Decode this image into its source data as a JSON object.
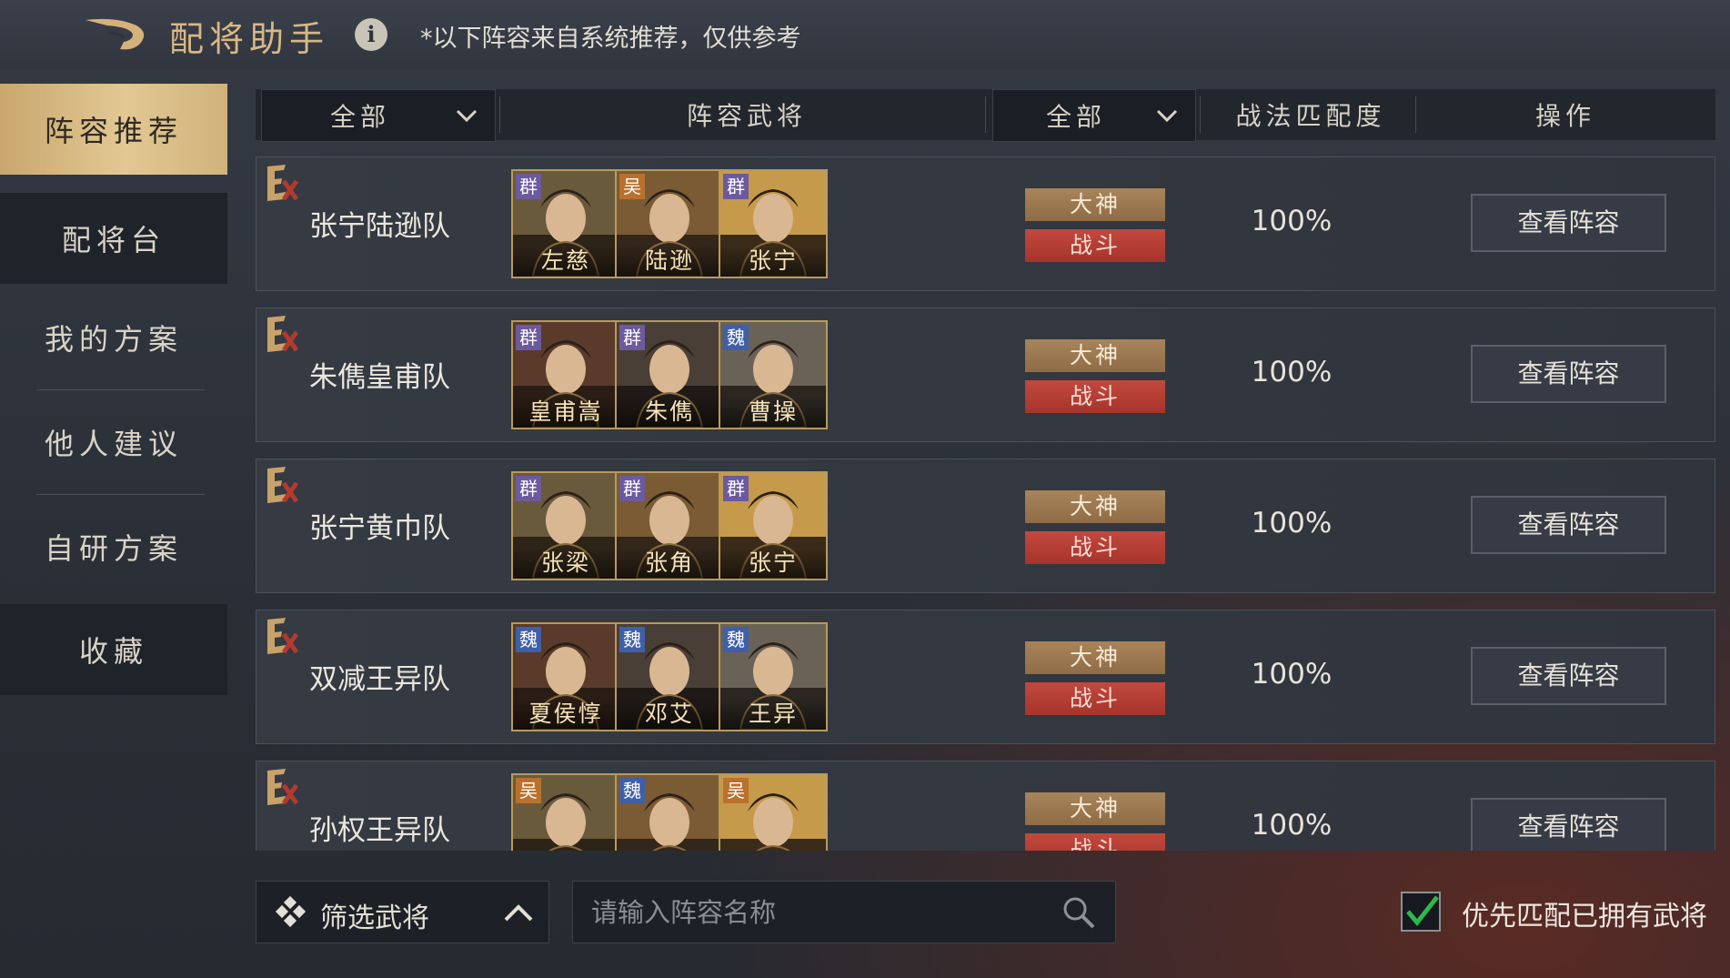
{
  "header": {
    "title": "配将助手",
    "info_icon": "info-icon",
    "info_glyph": "i",
    "notice": "*以下阵容来自系统推荐，仅供参考"
  },
  "sidebar": {
    "items": [
      {
        "label": "阵容推荐",
        "active": true
      },
      {
        "label": "配将台"
      },
      {
        "label": "我的方案"
      },
      {
        "label": "他人建议"
      },
      {
        "label": "自研方案"
      },
      {
        "label": "收藏"
      }
    ]
  },
  "table": {
    "headers": {
      "filter1": "全部",
      "lineup": "阵容武将",
      "filter2": "全部",
      "match": "战法匹配度",
      "action": "操作"
    },
    "rows": [
      {
        "name": "张宁陆逊队",
        "generals": [
          {
            "name": "左慈",
            "faction": "群"
          },
          {
            "name": "陆逊",
            "faction": "吴"
          },
          {
            "name": "张宁",
            "faction": "群"
          }
        ],
        "tags": [
          "大神",
          "战斗"
        ],
        "match": "100%",
        "button": "查看阵容"
      },
      {
        "name": "朱儁皇甫队",
        "generals": [
          {
            "name": "皇甫嵩",
            "faction": "群"
          },
          {
            "name": "朱儁",
            "faction": "群"
          },
          {
            "name": "曹操",
            "faction": "魏"
          }
        ],
        "tags": [
          "大神",
          "战斗"
        ],
        "match": "100%",
        "button": "查看阵容"
      },
      {
        "name": "张宁黄巾队",
        "generals": [
          {
            "name": "张梁",
            "faction": "群"
          },
          {
            "name": "张角",
            "faction": "群"
          },
          {
            "name": "张宁",
            "faction": "群"
          }
        ],
        "tags": [
          "大神",
          "战斗"
        ],
        "match": "100%",
        "button": "查看阵容"
      },
      {
        "name": "双减王异队",
        "generals": [
          {
            "name": "夏侯惇",
            "faction": "魏"
          },
          {
            "name": "邓艾",
            "faction": "魏"
          },
          {
            "name": "王异",
            "faction": "魏"
          }
        ],
        "tags": [
          "大神",
          "战斗"
        ],
        "match": "100%",
        "button": "查看阵容"
      },
      {
        "name": "孙权王异队",
        "generals": [
          {
            "name": "",
            "faction": "吴"
          },
          {
            "name": "",
            "faction": "魏"
          },
          {
            "name": "",
            "faction": "吴"
          }
        ],
        "tags": [
          "大神",
          "战斗"
        ],
        "match": "100%",
        "button": "查看阵容"
      }
    ]
  },
  "bottom": {
    "filter_label": "筛选武将",
    "search_placeholder": "请输入阵容名称",
    "checkbox_label": "优先匹配已拥有武将",
    "checkbox_checked": true
  },
  "colors": {
    "accent_gold": "#d8b786",
    "tag_gold": "#a8845a",
    "tag_red": "#c2493e",
    "check_green": "#2fb84a",
    "faction": {
      "群": "#6b5a9e",
      "吴": "#b9712e",
      "魏": "#3f5fa8"
    }
  }
}
